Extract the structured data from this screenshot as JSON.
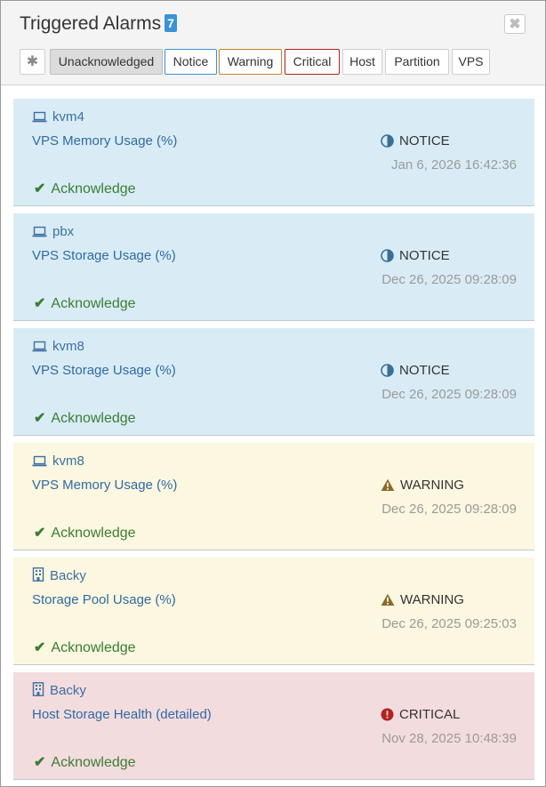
{
  "header": {
    "title": "Triggered Alarms",
    "count": "7",
    "close_icon": "close-icon",
    "filters": [
      {
        "label": "✱",
        "kind": "star"
      },
      {
        "label": "Unacknowledged",
        "kind": "active"
      },
      {
        "label": "Notice",
        "kind": "notice"
      },
      {
        "label": "Warning",
        "kind": "warning"
      },
      {
        "label": "Critical",
        "kind": "critical"
      },
      {
        "label": "Host",
        "kind": "plain"
      },
      {
        "label": "Partition",
        "kind": "plain"
      },
      {
        "label": "VPS",
        "kind": "plain"
      }
    ]
  },
  "colors": {
    "notice_bg": "#d9ecf6",
    "warning_bg": "#fcf7e0",
    "critical_bg": "#f3dcde",
    "notice_icon": "#3a6f96",
    "warning_icon": "#8a6a2a",
    "critical_icon": "#b22222",
    "acknowledge": "#3a7d34",
    "badge": "#3a93d6"
  },
  "alarms": [
    {
      "host": "kvm4",
      "host_icon": "laptop-icon",
      "metric": "VPS Memory Usage (%)",
      "level": "NOTICE",
      "level_icon": "half-circle-icon",
      "severity": "notice",
      "time": "Jan 6, 2026 16:42:36",
      "action": "Acknowledge"
    },
    {
      "host": "pbx",
      "host_icon": "laptop-icon",
      "metric": "VPS Storage Usage (%)",
      "level": "NOTICE",
      "level_icon": "half-circle-icon",
      "severity": "notice",
      "time": "Dec 26, 2025 09:28:09",
      "action": "Acknowledge"
    },
    {
      "host": "kvm8",
      "host_icon": "laptop-icon",
      "metric": "VPS Storage Usage (%)",
      "level": "NOTICE",
      "level_icon": "half-circle-icon",
      "severity": "notice",
      "time": "Dec 26, 2025 09:28:09",
      "action": "Acknowledge"
    },
    {
      "host": "kvm8",
      "host_icon": "laptop-icon",
      "metric": "VPS Memory Usage (%)",
      "level": "WARNING",
      "level_icon": "warning-triangle-icon",
      "severity": "warning",
      "time": "Dec 26, 2025 09:28:09",
      "action": "Acknowledge"
    },
    {
      "host": "Backy",
      "host_icon": "building-icon",
      "metric": "Storage Pool Usage (%)",
      "level": "WARNING",
      "level_icon": "warning-triangle-icon",
      "severity": "warning",
      "time": "Dec 26, 2025 09:25:03",
      "action": "Acknowledge"
    },
    {
      "host": "Backy",
      "host_icon": "building-icon",
      "metric": "Host Storage Health (detailed)",
      "level": "CRITICAL",
      "level_icon": "exclamation-circle-icon",
      "severity": "critical",
      "time": "Nov 28, 2025 10:48:39",
      "action": "Acknowledge"
    }
  ]
}
